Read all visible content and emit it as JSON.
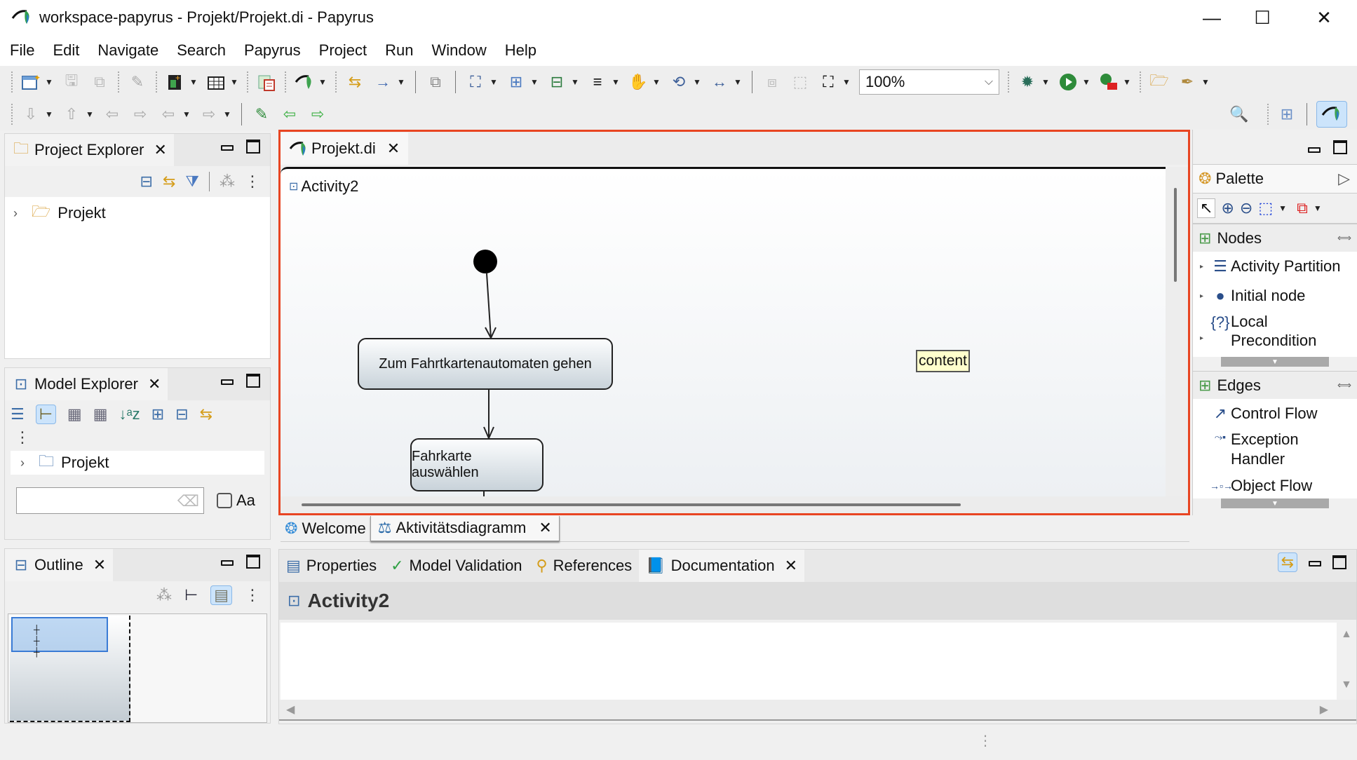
{
  "window": {
    "title": "workspace-papyrus - Projekt/Projekt.di - Papyrus",
    "minimize": "—",
    "maximize": "☐",
    "close": "✕"
  },
  "menu": [
    "File",
    "Edit",
    "Navigate",
    "Search",
    "Papyrus",
    "Project",
    "Run",
    "Window",
    "Help"
  ],
  "toolbar": {
    "zoom_value": "100%"
  },
  "project_explorer": {
    "title": "Project Explorer",
    "tree": [
      {
        "label": "Projekt",
        "icon": "folder-open-icon"
      }
    ]
  },
  "model_explorer": {
    "title": "Model Explorer",
    "tree": [
      {
        "label": "Projekt",
        "icon": "model-icon"
      }
    ],
    "filter_placeholder": "",
    "case_label": "Aa"
  },
  "outline": {
    "title": "Outline"
  },
  "editor": {
    "tab_label": "Projekt.di",
    "diagram_name": "Activity2",
    "nodes": [
      {
        "type": "initial-node"
      },
      {
        "type": "action",
        "label": "Zum Fahrtkartenautomaten gehen"
      },
      {
        "type": "action",
        "label": "Fahrkarte auswählen"
      }
    ],
    "comment_label": "content",
    "bottom_tabs": [
      {
        "label": "Welcome",
        "closable": false
      },
      {
        "label": "Aktivitätsdiagramm",
        "closable": true,
        "active": true
      }
    ]
  },
  "palette": {
    "title": "Palette",
    "drawers": [
      {
        "label": "Nodes",
        "items": [
          {
            "label": "Activity Partition",
            "icon": "partition-icon"
          },
          {
            "label": "Initial node",
            "icon": "initial-node-icon"
          },
          {
            "label": "Local Precondition",
            "icon": "precondition-icon"
          }
        ]
      },
      {
        "label": "Edges",
        "items": [
          {
            "label": "Control Flow",
            "icon": "control-flow-icon"
          },
          {
            "label": "Exception Handler",
            "icon": "exception-handler-icon"
          },
          {
            "label": "Object Flow",
            "icon": "object-flow-icon"
          }
        ]
      }
    ]
  },
  "bottom_panel": {
    "tabs": [
      {
        "label": "Properties",
        "icon": "properties-icon"
      },
      {
        "label": "Model Validation",
        "icon": "check-icon"
      },
      {
        "label": "References",
        "icon": "references-icon"
      },
      {
        "label": "Documentation",
        "icon": "documentation-icon",
        "active": true,
        "closable": true
      }
    ],
    "selected_element": "Activity2",
    "documentation_text": ""
  },
  "colors": {
    "highlight_border": "#e84522",
    "comment_bg": "#ffffcc",
    "active_toggle": "#cce4fb"
  }
}
